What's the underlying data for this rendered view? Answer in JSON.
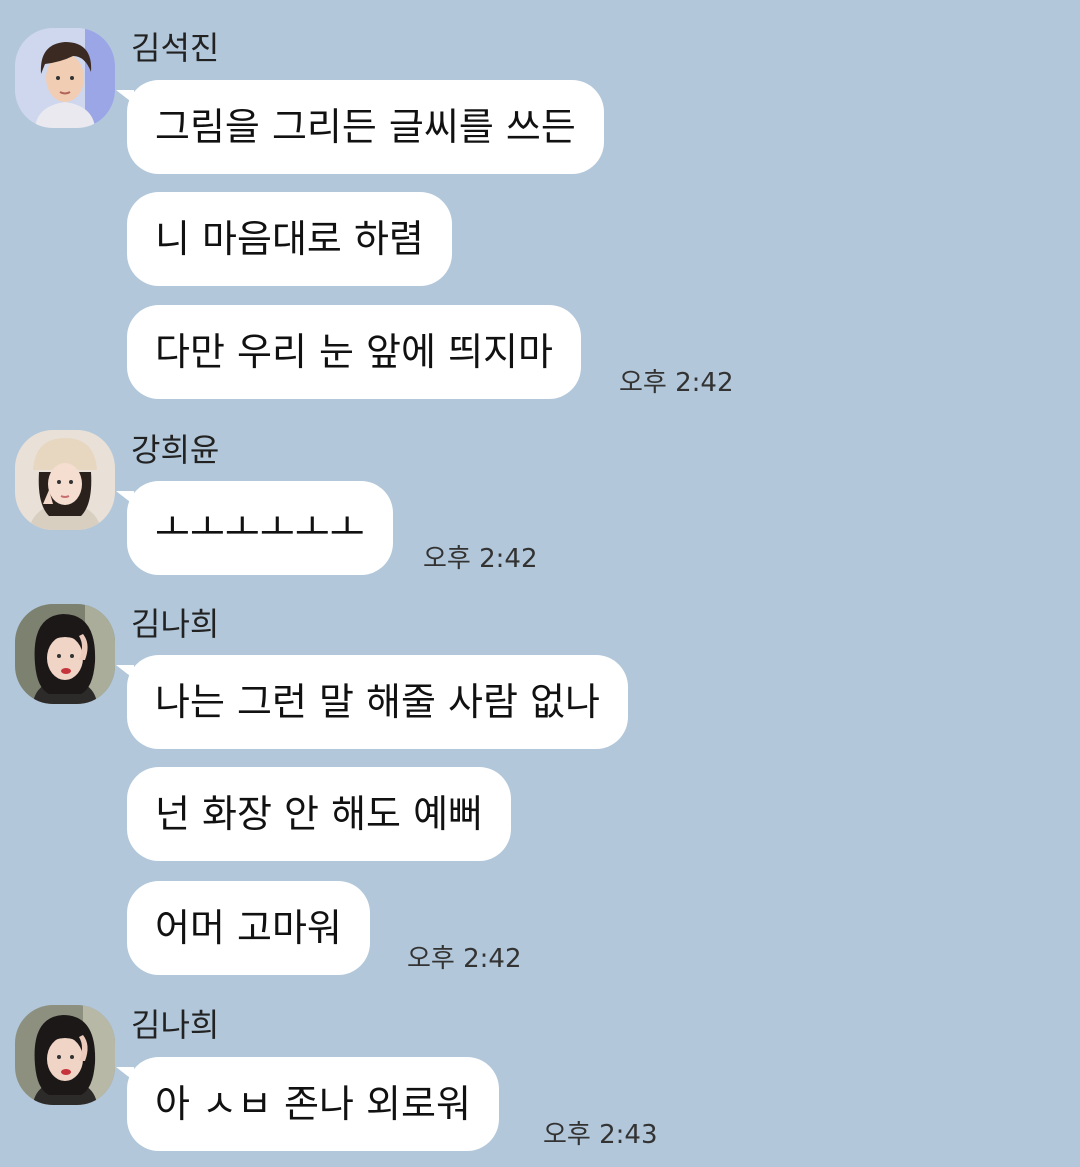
{
  "groups": [
    {
      "sender": "김석진",
      "avatar_icon": "profile-photo-man-icon",
      "messages": [
        "그림을 그리든 글씨를 쓰든",
        "니 마음대로 하렴",
        "다만 우리 눈 앞에 띄지마"
      ],
      "time": "오후 2:42"
    },
    {
      "sender": "강희윤",
      "avatar_icon": "profile-photo-woman-hat-icon",
      "messages": [
        "ㅗㅗㅗㅗㅗㅗ"
      ],
      "time": "오후 2:42"
    },
    {
      "sender": "김나희",
      "avatar_icon": "profile-photo-woman-icon",
      "messages": [
        "나는 그런 말 해줄 사람 없나",
        "넌 화장 안 해도 예뻐",
        "어머 고마워"
      ],
      "time": "오후 2:42"
    },
    {
      "sender": "김나희",
      "avatar_icon": "profile-photo-woman-icon",
      "messages": [
        "아 ㅅㅂ 존나 외로워"
      ],
      "time": "오후 2:43"
    }
  ]
}
